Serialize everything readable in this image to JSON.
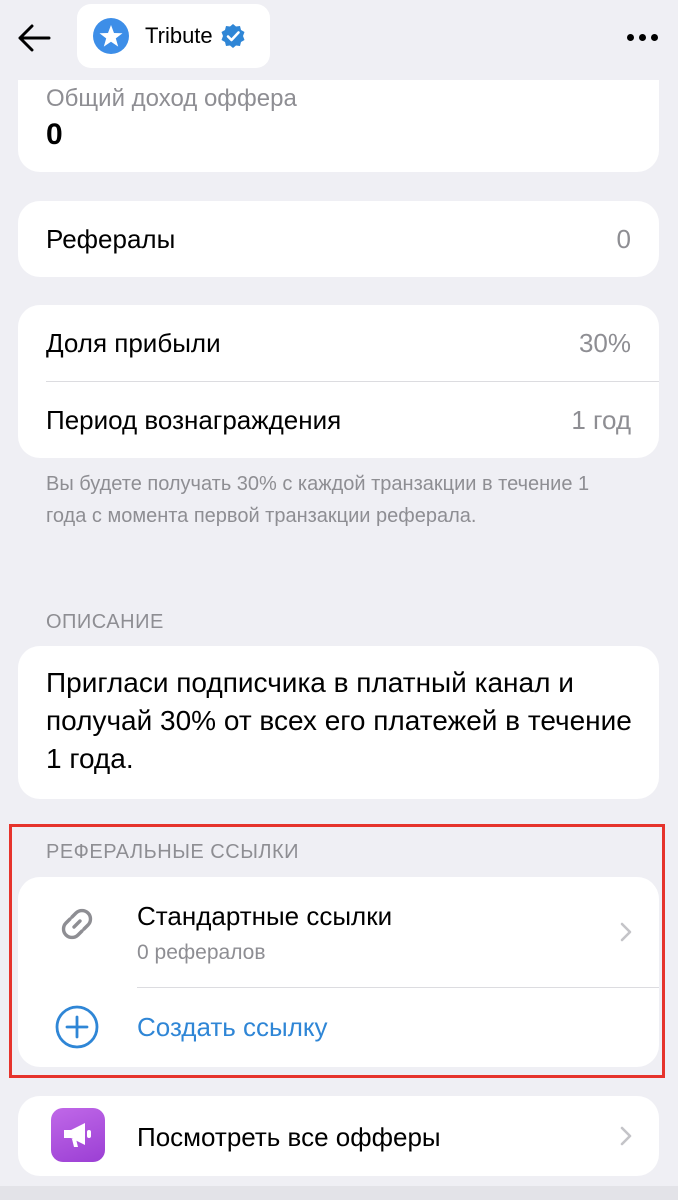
{
  "header": {
    "app_name": "Tribute",
    "back_icon": "arrow-left-icon",
    "more_icon": "more-horizontal-icon"
  },
  "income": {
    "label": "Общий доход оффера",
    "value": "0"
  },
  "referrals": {
    "label": "Рефералы",
    "value": "0"
  },
  "terms": {
    "profit_share_label": "Доля прибыли",
    "profit_share_value": "30%",
    "period_label": "Период вознаграждения",
    "period_value": "1 год",
    "note": "Вы будете получать 30% с каждой транзакции в течение 1 года с момента первой транзакции реферала."
  },
  "description": {
    "section_title": "ОПИСАНИЕ",
    "text": "Пригласи подписчика в платный канал и получай 30% от всех его платежей в течение 1 года."
  },
  "referral_links": {
    "section_title": "РЕФЕРАЛЬНЫЕ ССЫЛКИ",
    "standard_title": "Стандартные ссылки",
    "standard_subtitle": "0 рефералов",
    "create_label": "Создать ссылку"
  },
  "offers": {
    "label": "Посмотреть все офферы"
  },
  "colors": {
    "background": "#efeff4",
    "card": "#ffffff",
    "accent_blue": "#2f86d6",
    "secondary_text": "#8e8e93",
    "highlight_red": "#e6332c",
    "offers_icon_purple": "#b052e0"
  }
}
